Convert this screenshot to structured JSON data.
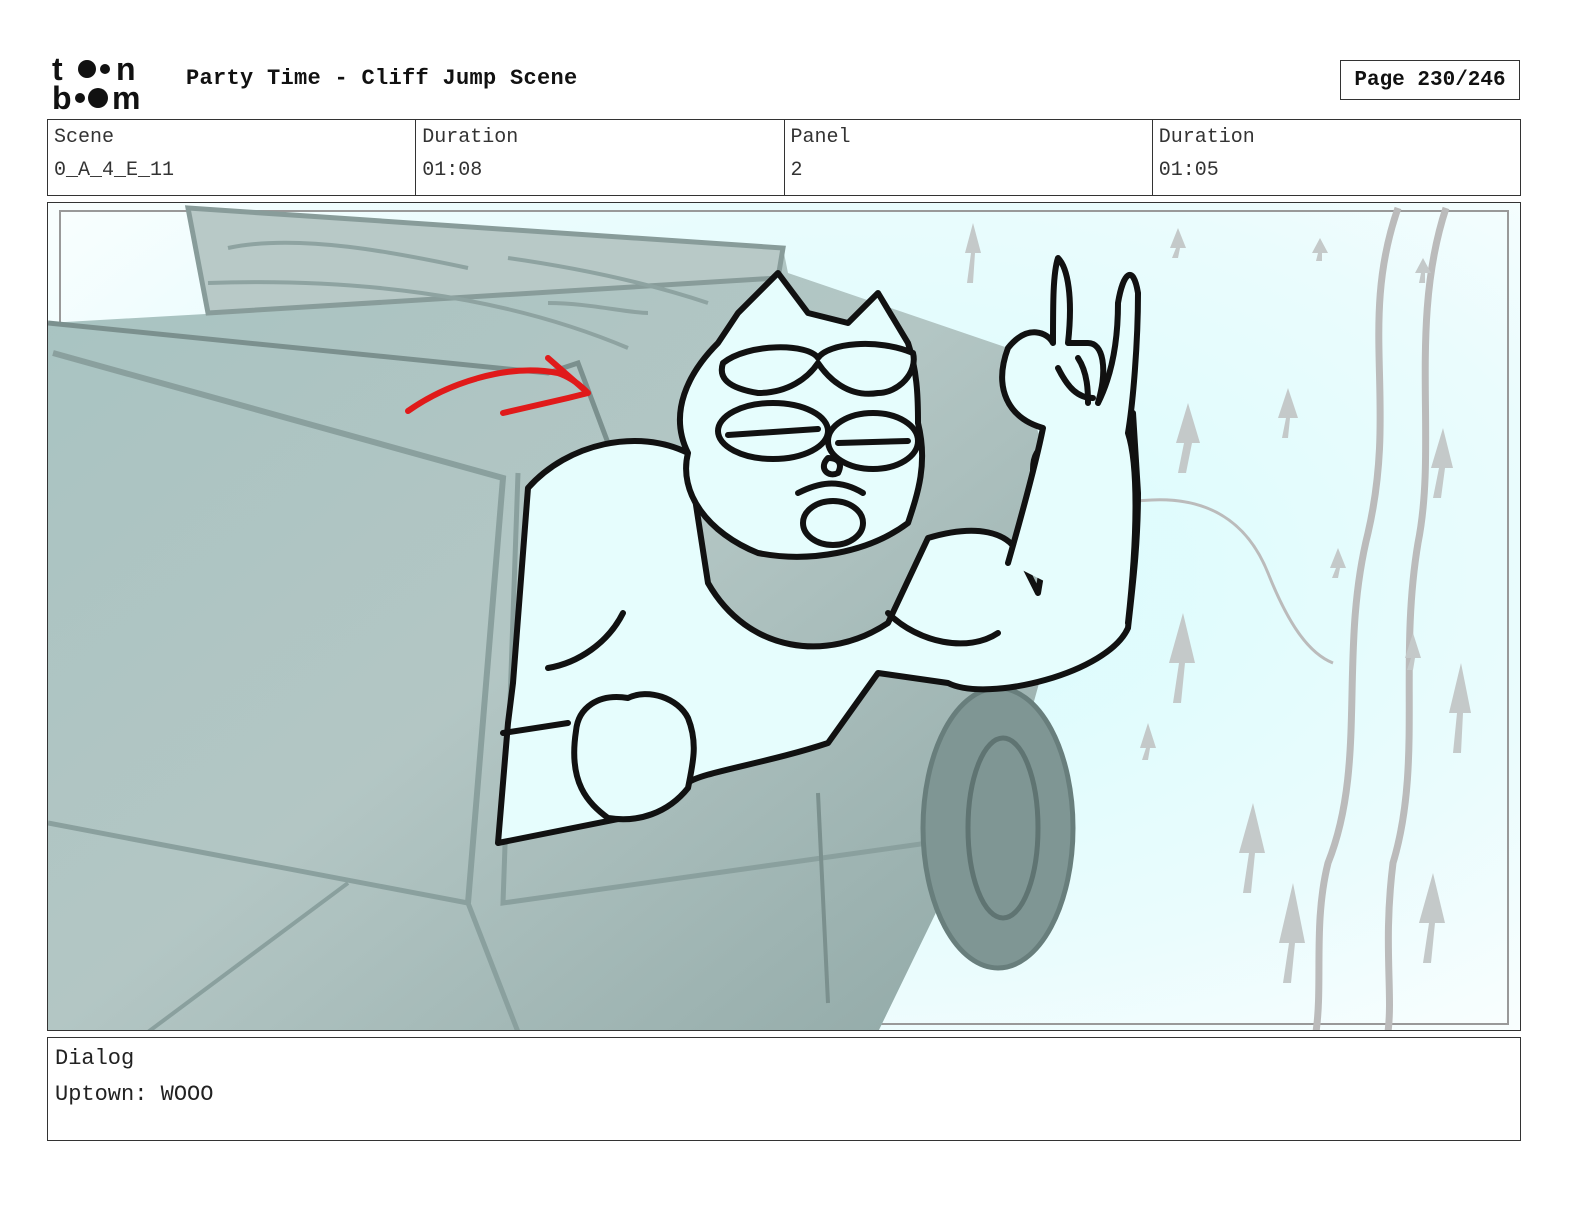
{
  "header": {
    "logo_name": "toon-boom-logo",
    "title": "Party Time - Cliff Jump Scene",
    "page": "Page 230/246"
  },
  "info": {
    "scene_label": "Scene",
    "scene_value": "0_A_4_E_11",
    "scene_duration_label": "Duration",
    "scene_duration_value": "01:08",
    "panel_label": "Panel",
    "panel_value": "2",
    "panel_duration_label": "Duration",
    "panel_duration_value": "01:05"
  },
  "dialog": {
    "label": "Dialog",
    "text": "Uptown: WOOO"
  },
  "colors": {
    "sky": "#e4fbfd",
    "truck": "#9fb6b4",
    "arrow": "#e01a1a",
    "ink": "#111111"
  }
}
